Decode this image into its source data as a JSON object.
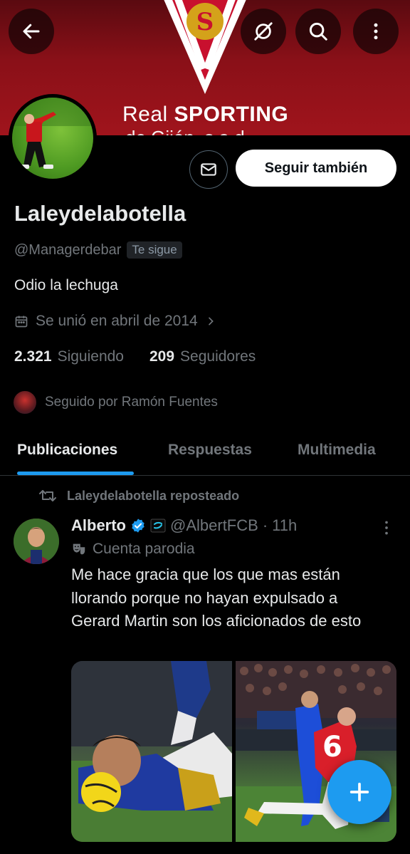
{
  "banner": {
    "brand_light": "Real",
    "brand_bold": "SPORTING",
    "brand_sub": "de Gijón, s.a.d."
  },
  "header_actions": {
    "back_icon": "arrow-left-icon",
    "grok_icon": "grok-icon",
    "search_icon": "search-icon",
    "more_icon": "more-vertical-icon"
  },
  "profile": {
    "display_name": "Laleydelabotella",
    "handle": "@Managerdebar",
    "follows_you": "Te sigue",
    "bio": "Odio la lechuga",
    "joined": "Se unió en abril de 2014",
    "following_count": "2.321",
    "following_label": "Siguiendo",
    "followers_count": "209",
    "followers_label": "Seguidores",
    "followed_by": "Seguido por Ramón Fuentes",
    "follow_button": "Seguir también"
  },
  "tabs": [
    {
      "label": "Publicaciones",
      "active": true
    },
    {
      "label": "Respuestas",
      "active": false
    },
    {
      "label": "Multimedia",
      "active": false
    }
  ],
  "post": {
    "repost_label": "Laleydelabotella reposteado",
    "author_name": "Alberto",
    "author_handle": "@AlbertFCB",
    "separator": "·",
    "time": "11h",
    "parody_label": "Cuenta parodia",
    "text": "Me hace gracia que los que mas están llorando porque no hayan expulsado a Gerard Martin son los aficionados de esto"
  },
  "colors": {
    "accent": "#1d9bf0",
    "background": "#000000",
    "banner_red": "#a0141c",
    "muted_text": "#71767b"
  }
}
